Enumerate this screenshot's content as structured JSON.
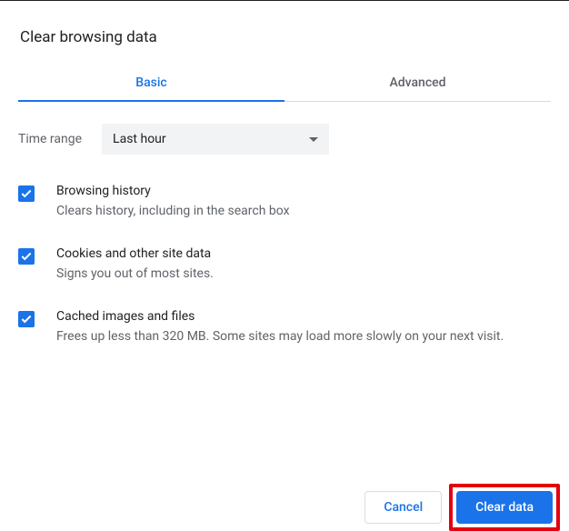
{
  "title": "Clear browsing data",
  "tabs": {
    "basic": "Basic",
    "advanced": "Advanced"
  },
  "time_range": {
    "label": "Time range",
    "value": "Last hour"
  },
  "options": [
    {
      "title": "Browsing history",
      "desc": "Clears history, including in the search box",
      "checked": true
    },
    {
      "title": "Cookies and other site data",
      "desc": "Signs you out of most sites.",
      "checked": true
    },
    {
      "title": "Cached images and files",
      "desc": "Frees up less than 320 MB. Some sites may load more slowly on your next visit.",
      "checked": true
    }
  ],
  "buttons": {
    "cancel": "Cancel",
    "clear": "Clear data"
  }
}
